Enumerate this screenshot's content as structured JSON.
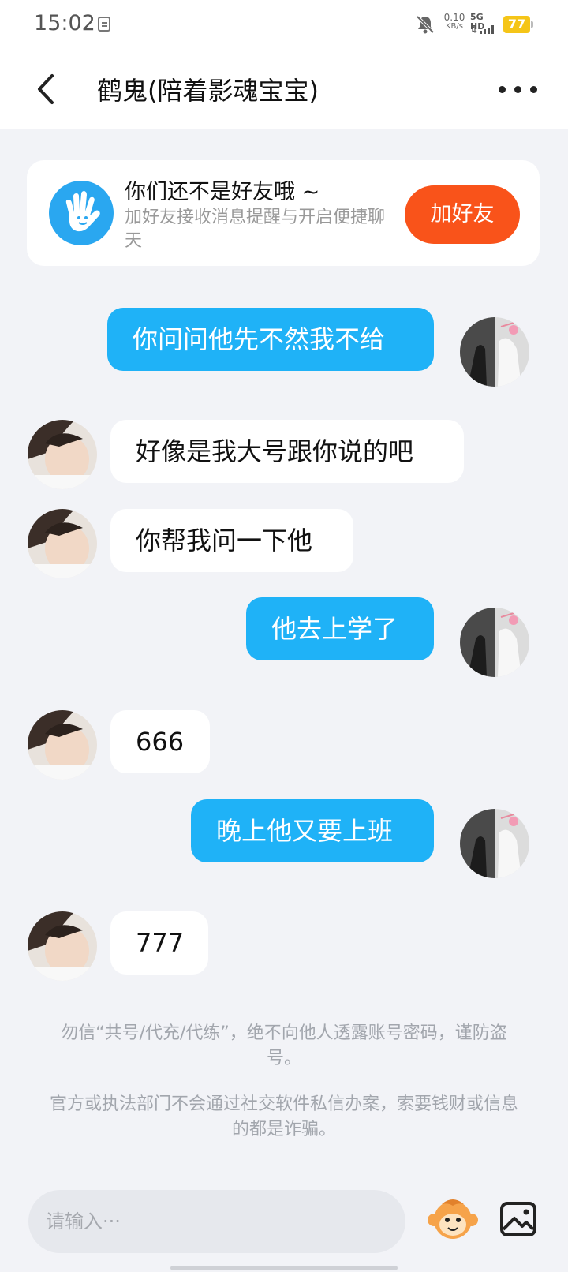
{
  "status_bar": {
    "time": "15:02",
    "speed_value": "0.10",
    "speed_unit": "KB/s",
    "network": "5G HD",
    "battery": "77"
  },
  "header": {
    "title": "鹤鬼(陪着影魂宝宝)"
  },
  "friend_card": {
    "title": "你们还不是好友哦 ~",
    "description": "加好友接收消息提醒与开启便捷聊天",
    "button": "加好友"
  },
  "messages": [
    {
      "direction": "out",
      "text": "你问问他先不然我不给"
    },
    {
      "direction": "in",
      "text": "好像是我大号跟你说的吧"
    },
    {
      "direction": "in",
      "text": "你帮我问一下他"
    },
    {
      "direction": "out",
      "text": "他去上学了"
    },
    {
      "direction": "in",
      "text": "666"
    },
    {
      "direction": "out",
      "text": "晚上他又要上班"
    },
    {
      "direction": "in",
      "text": "777"
    }
  ],
  "notices": [
    "勿信“共号/代充/代练”，绝不向他人透露账号密码，谨防盗号。",
    "官方或执法部门不会通过社交软件私信办案，索要钱财或信息的都是诈骗。"
  ],
  "input": {
    "placeholder": "请输入···"
  },
  "icons": {
    "back": "chevron-left-icon",
    "more": "more-dots-icon",
    "friend": "waving-hand-icon",
    "emoji": "monkey-emoji-icon",
    "image": "image-icon"
  },
  "colors": {
    "outgoing_bubble": "#1fb2f7",
    "add_friend_button": "#f9531a",
    "friend_icon": "#2aa7f0"
  }
}
